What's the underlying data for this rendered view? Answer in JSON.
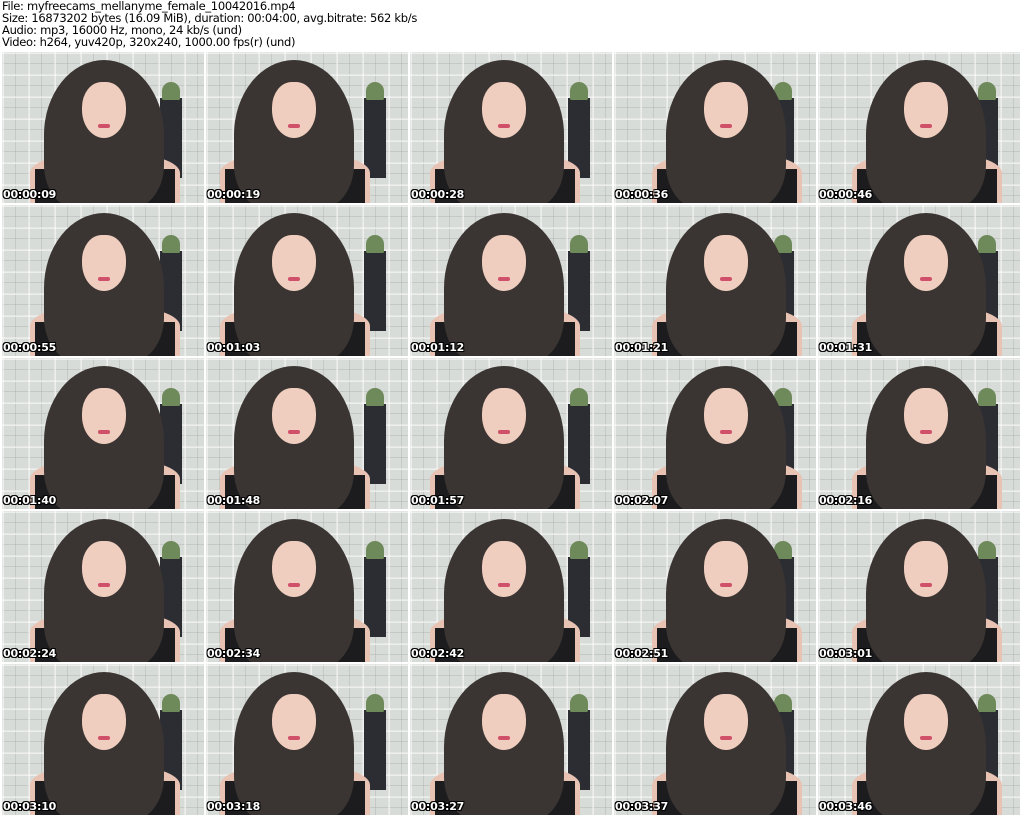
{
  "header": {
    "file": "File: myfreecams_mellanyme_female_10042016.mp4",
    "size": "Size: 16873202 bytes (16.09 MiB), duration: 00:04:00, avg.bitrate: 562 kb/s",
    "audio": "Audio: mp3, 16000 Hz, mono, 24 kb/s (und)",
    "video": "Video: h264, yuv420p, 320x240, 1000.00 fps(r) (und)"
  },
  "thumbnails": [
    {
      "timestamp": "00:00:09"
    },
    {
      "timestamp": "00:00:19"
    },
    {
      "timestamp": "00:00:28"
    },
    {
      "timestamp": "00:00:36"
    },
    {
      "timestamp": "00:00:46"
    },
    {
      "timestamp": "00:00:55"
    },
    {
      "timestamp": "00:01:03"
    },
    {
      "timestamp": "00:01:12"
    },
    {
      "timestamp": "00:01:21"
    },
    {
      "timestamp": "00:01:31"
    },
    {
      "timestamp": "00:01:40"
    },
    {
      "timestamp": "00:01:48"
    },
    {
      "timestamp": "00:01:57"
    },
    {
      "timestamp": "00:02:07"
    },
    {
      "timestamp": "00:02:16"
    },
    {
      "timestamp": "00:02:24"
    },
    {
      "timestamp": "00:02:34"
    },
    {
      "timestamp": "00:02:42"
    },
    {
      "timestamp": "00:02:51"
    },
    {
      "timestamp": "00:03:01"
    },
    {
      "timestamp": "00:03:10"
    },
    {
      "timestamp": "00:03:18"
    },
    {
      "timestamp": "00:03:27"
    },
    {
      "timestamp": "00:03:37"
    },
    {
      "timestamp": "00:03:46"
    }
  ]
}
